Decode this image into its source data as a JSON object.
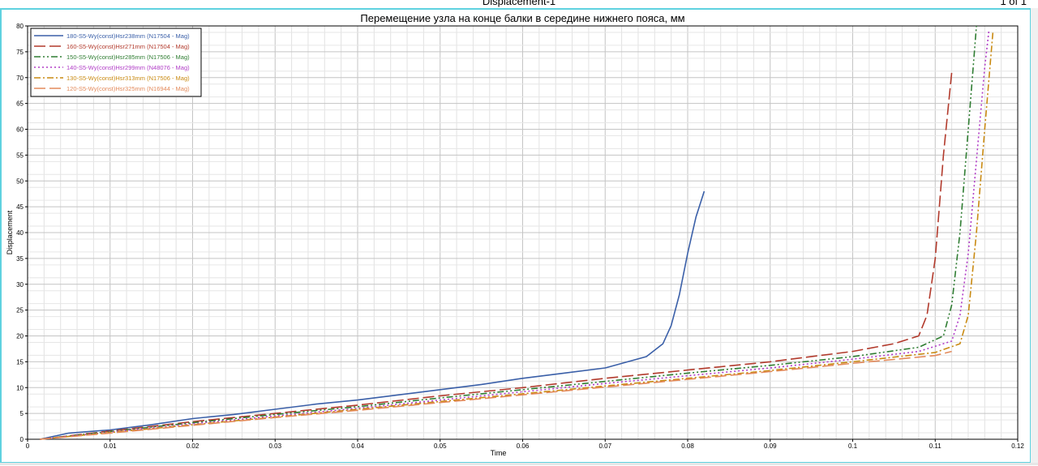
{
  "window": {
    "title": "Displacement-1",
    "page_indicator": "1 of 1"
  },
  "colors": {
    "frame_border": "#5fd2e0",
    "grid": "#c8c8c8",
    "axis": "#000000"
  },
  "chart_data": {
    "type": "line",
    "title": "Перемещение узла на конце балки в середине нижнего пояса, мм",
    "xlabel": "Time",
    "ylabel": "Displacement",
    "xlim": [
      0,
      0.12
    ],
    "ylim": [
      0,
      80
    ],
    "x_ticks": [
      "0",
      "0.01",
      "0.02",
      "0.03",
      "0.04",
      "0.05",
      "0.06",
      "0.07",
      "0.08",
      "0.09",
      "0.1",
      "0.11",
      "0.12"
    ],
    "y_ticks": [
      "0",
      "5",
      "10",
      "15",
      "20",
      "25",
      "30",
      "35",
      "40",
      "45",
      "50",
      "55",
      "60",
      "65",
      "70",
      "75",
      "80"
    ],
    "grid": true,
    "legend_position": "top-left",
    "series": [
      {
        "name": "180-S5-Wy(const)Hsr238mm (N17504 - Mag)",
        "color": "#3a5fa8",
        "dash": "solid",
        "x": [
          0.0015,
          0.005,
          0.01,
          0.015,
          0.02,
          0.025,
          0.03,
          0.035,
          0.04,
          0.045,
          0.05,
          0.055,
          0.06,
          0.065,
          0.07,
          0.075,
          0.077,
          0.078,
          0.079,
          0.08,
          0.081,
          0.082
        ],
        "y": [
          0,
          1.2,
          1.8,
          2.8,
          4.0,
          4.8,
          5.8,
          6.8,
          7.6,
          8.6,
          9.6,
          10.6,
          11.8,
          12.8,
          13.8,
          16.0,
          18.5,
          22.0,
          28.0,
          36.0,
          43.0,
          48.0
        ]
      },
      {
        "name": "160-S5-Wy(const)Hsr271mm (N17504 - Mag)",
        "color": "#b23a2c",
        "dash": "longdash",
        "x": [
          0.0015,
          0.01,
          0.02,
          0.03,
          0.04,
          0.05,
          0.06,
          0.07,
          0.08,
          0.09,
          0.1,
          0.105,
          0.108,
          0.109,
          0.11,
          0.111,
          0.112
        ],
        "y": [
          0,
          1.6,
          3.4,
          5.0,
          6.6,
          8.4,
          10.0,
          11.8,
          13.4,
          15.0,
          17.0,
          18.5,
          20.0,
          24.0,
          35.0,
          55.0,
          71.0
        ]
      },
      {
        "name": "150-S5-Wy(const)Hsr285mm (N17506 - Mag)",
        "color": "#2f7d32",
        "dash": "dashdotdot",
        "x": [
          0.0015,
          0.01,
          0.02,
          0.03,
          0.04,
          0.05,
          0.06,
          0.07,
          0.08,
          0.09,
          0.1,
          0.108,
          0.111,
          0.112,
          0.113,
          0.114,
          0.115
        ],
        "y": [
          0,
          1.5,
          3.2,
          4.8,
          6.3,
          8.0,
          9.6,
          11.2,
          12.8,
          14.3,
          16.0,
          17.8,
          20.0,
          26.0,
          40.0,
          60.0,
          80.0
        ]
      },
      {
        "name": "140-S5-Wy(const)Hsr299mm (N48076 - Mag)",
        "color": "#b03cc6",
        "dash": "dotted",
        "x": [
          0.0015,
          0.01,
          0.02,
          0.03,
          0.04,
          0.05,
          0.06,
          0.07,
          0.08,
          0.09,
          0.1,
          0.108,
          0.112,
          0.113,
          0.114,
          0.115,
          0.116,
          0.1165
        ],
        "y": [
          0,
          1.4,
          3.0,
          4.5,
          6.0,
          7.6,
          9.2,
          10.8,
          12.3,
          13.8,
          15.5,
          17.0,
          19.0,
          24.0,
          36.0,
          54.0,
          72.0,
          79.0
        ]
      },
      {
        "name": "130-S5-Wy(const)Hsr313mm (N17506 - Mag)",
        "color": "#c98a12",
        "dash": "dashdot",
        "x": [
          0.0015,
          0.01,
          0.02,
          0.03,
          0.04,
          0.05,
          0.06,
          0.07,
          0.08,
          0.09,
          0.1,
          0.11,
          0.113,
          0.114,
          0.115,
          0.116,
          0.117
        ],
        "y": [
          0,
          1.3,
          2.8,
          4.3,
          5.8,
          7.3,
          8.8,
          10.3,
          11.8,
          13.3,
          15.0,
          16.8,
          18.5,
          24.0,
          40.0,
          60.0,
          79.0
        ]
      },
      {
        "name": "120-S5-Wy(const)Hsr325mm (N16944 - Mag)",
        "color": "#e38a5b",
        "dash": "longdash",
        "x": [
          0.0015,
          0.01,
          0.02,
          0.03,
          0.04,
          0.05,
          0.06,
          0.07,
          0.08,
          0.09,
          0.1,
          0.11,
          0.112
        ],
        "y": [
          0,
          1.2,
          2.7,
          4.2,
          5.6,
          7.1,
          8.6,
          10.1,
          11.6,
          13.1,
          14.7,
          16.2,
          17.0
        ]
      }
    ]
  }
}
